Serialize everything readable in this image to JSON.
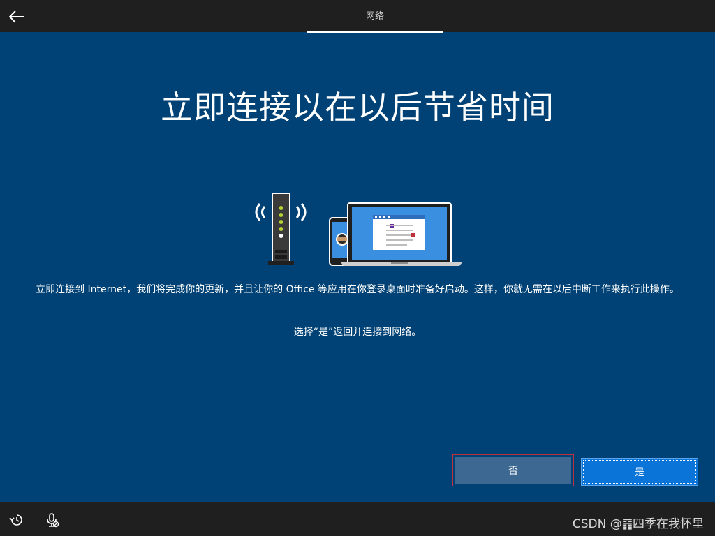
{
  "header": {
    "back_icon": "back-arrow-icon",
    "tab_label": "网络"
  },
  "main": {
    "title": "立即连接以在以后节省时间",
    "illustration_icons": [
      "router-icon",
      "wifi-signal-icon",
      "phone-icon",
      "laptop-icon"
    ],
    "description": "立即连接到 Internet，我们将完成你的更新，并且让你的 Office 等应用在你登录桌面时准备好启动。这样，你就无需在以后中断工作来执行此操作。",
    "hint": "选择“是”返回并连接到网络。"
  },
  "buttons": {
    "no_label": "否",
    "yes_label": "是"
  },
  "footer": {
    "ease_of_access_icon": "ease-of-access-icon",
    "microphone_icon": "microphone-muted-icon",
    "watermark": "CSDN @䷢四季在我怀里"
  },
  "colors": {
    "background": "#004275",
    "bar": "#1f1f1f",
    "primary_button": "#0a74d8",
    "secondary_button": "#3d6892",
    "focus_border": "#c0303d"
  }
}
